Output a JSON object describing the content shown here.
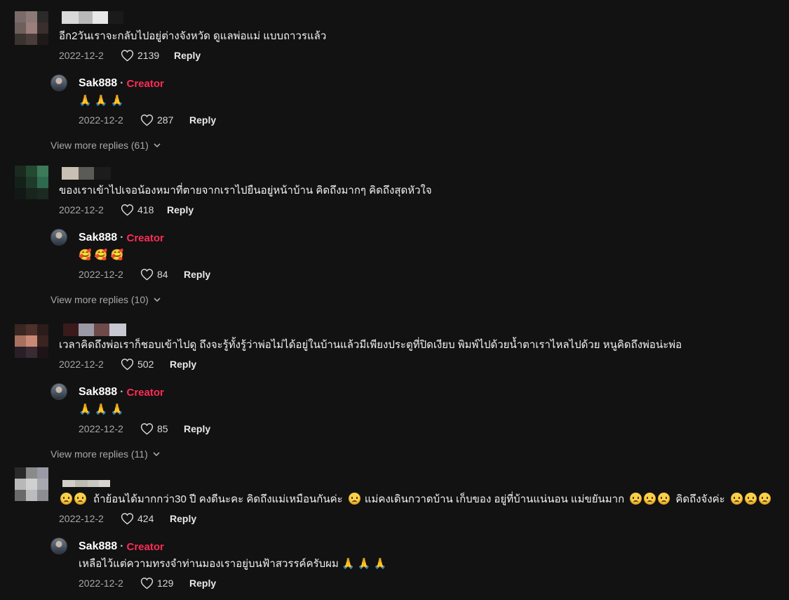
{
  "comments": [
    {
      "text": "อีก2วันเราจะกลับไปอยู่ต่างจังหวัด ดูแลพ่อแม่ แบบถาวรแล้ว",
      "date": "2022-12-2",
      "likes": "2139",
      "reply": "Reply",
      "avatar_colors": [
        "#7a6a6a",
        "#8c7a78",
        "#2a2a2a",
        "#6d5f5c",
        "#9a7f7c",
        "#3a2f2d",
        "#3b3330",
        "#4a3d39",
        "#1f1a19"
      ],
      "name_colors": [
        "#d9d9d9",
        "#b9b9b9",
        "#e8e8e8",
        "#1a1a1a"
      ],
      "creator_reply": {
        "name": "Sak888",
        "sep": "·",
        "badge": "Creator",
        "text": "🙏 🙏 🙏",
        "date": "2022-12-2",
        "likes": "287",
        "reply": "Reply"
      },
      "view_more": "View more replies (61)"
    },
    {
      "text": "ของเราเข้าไปเจอน้องหมาที่ตายจากเราไปยืนอยู่หน้าบ้าน คิดถึงมากๆ คิดถึงสุดหัวใจ",
      "date": "2022-12-2",
      "likes": "418",
      "reply": "Reply",
      "avatar_colors": [
        "#1a2a1e",
        "#234a30",
        "#3c7a5a",
        "#14201a",
        "#1f3a2a",
        "#2e6a4e",
        "#121815",
        "#18241c",
        "#1c2b22"
      ],
      "name_colors": [
        "#c9bfb2",
        "#5a5a57",
        "#1c1c1c"
      ],
      "creator_reply": {
        "name": "Sak888",
        "sep": "·",
        "badge": "Creator",
        "text": "🥰 🥰 🥰",
        "date": "2022-12-2",
        "likes": "84",
        "reply": "Reply"
      },
      "view_more": "View more replies (10)"
    },
    {
      "text": "เวลาคิดถึงพ่อเราก็ชอบเข้าไปดู ถึงจะรู้ทั้งรู้ว่าพ่อไม่ได้อยู่ในบ้านแล้วมีเพียงประตูที่ปิดเงียบ พิมพ์ไปด้วยน้ำตาเราไหลไปด้วย หนูคิดถึงพ่อน่ะพ่อ",
      "date": "2022-12-2",
      "likes": "502",
      "reply": "Reply",
      "avatar_colors": [
        "#3a2622",
        "#4c302a",
        "#2a1c1a",
        "#a8705e",
        "#c88a74",
        "#3a2420",
        "#2a1e28",
        "#3a2a34",
        "#1e1418"
      ],
      "name_colors": [
        "#3a1a1a",
        "#9a9aa6",
        "#6e4a4a",
        "#c8c8d2"
      ],
      "creator_reply": {
        "name": "Sak888",
        "sep": "·",
        "badge": "Creator",
        "text": "🙏 🙏 🙏",
        "date": "2022-12-2",
        "likes": "85",
        "reply": "Reply"
      },
      "view_more": "View more replies (11)"
    },
    {
      "text": "ถ้าย้อนได้มากกว่า30 ปี คงดีนะคะ คิดถึงแม่เหมือนกันค่ะ",
      "text_b": "แม่คงเดินกวาดบ้าน เก็บของ อยู่ที่บ้านแน่นอน แม่ขยันมาก",
      "text_c": "คิดถึงจังค่ะ",
      "date": "2022-12-2",
      "likes": "424",
      "reply": "Reply",
      "avatar_colors": [
        "#2a2a2a",
        "#8a8a8a",
        "#9a9aa6",
        "#b8b8b8",
        "#d0d0d0",
        "#a8a8b0",
        "#6a6a6a",
        "#bcbcc0",
        "#8e8e92"
      ],
      "name_colors": [
        "#d0d0c8",
        "#bcbcb4",
        "#c8c8c0",
        "#d6d6ce"
      ],
      "creator_reply": {
        "name": "Sak888",
        "sep": "·",
        "badge": "Creator",
        "text": "เหลือไว้แต่ความทรงจำท่านมองเราอยู่บนฟ้าสวรรค์ครับผม 🙏 🙏 🙏",
        "date": "2022-12-2",
        "likes": "129",
        "reply": "Reply"
      }
    }
  ]
}
